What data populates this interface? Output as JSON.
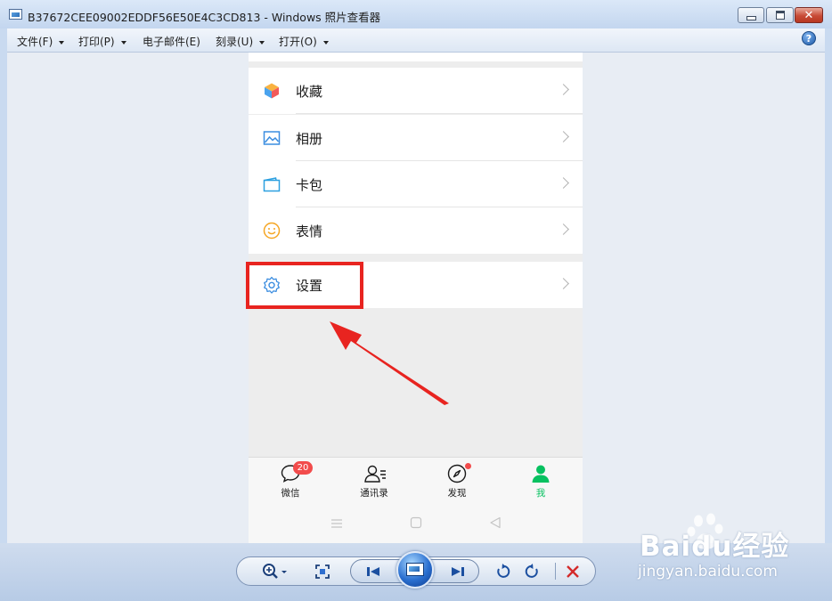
{
  "window": {
    "title": "B37672CEE09002EDDF56E50E4C3CD813 - Windows 照片查看器",
    "close_label": "✕"
  },
  "menubar": {
    "items": [
      {
        "label": "文件(F)",
        "has_dropdown": true
      },
      {
        "label": "打印(P)",
        "has_dropdown": true
      },
      {
        "label": "电子邮件(E)",
        "has_dropdown": false
      },
      {
        "label": "刻录(U)",
        "has_dropdown": true
      },
      {
        "label": "打开(O)",
        "has_dropdown": true
      }
    ],
    "help_label": "?"
  },
  "phone": {
    "list_items": [
      {
        "label": "收藏",
        "icon": "favorites-cube-icon"
      },
      {
        "label": "相册",
        "icon": "album-picture-icon"
      },
      {
        "label": "卡包",
        "icon": "card-wallet-icon"
      },
      {
        "label": "表情",
        "icon": "sticker-smile-icon"
      }
    ],
    "settings": {
      "label": "设置",
      "icon": "gear-icon"
    },
    "tabs": [
      {
        "label": "微信",
        "icon": "chat-bubble-icon",
        "badge": "20"
      },
      {
        "label": "通讯录",
        "icon": "contacts-icon"
      },
      {
        "label": "发现",
        "icon": "discover-compass-icon"
      },
      {
        "label": "我",
        "icon": "me-person-icon",
        "active": true
      }
    ],
    "active_color": "#07c160",
    "badge_color": "#f24c4c"
  },
  "annotation": {
    "highlight_color": "#e82420"
  },
  "watermark": {
    "logo": "Baidu经验",
    "url": "jingyan.baidu.com"
  }
}
